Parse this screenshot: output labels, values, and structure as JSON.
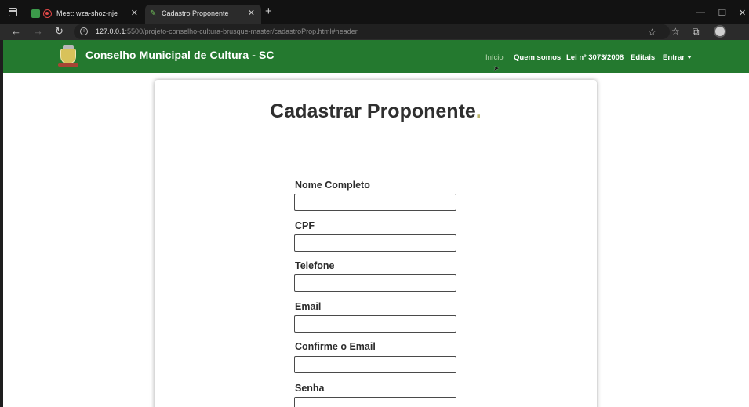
{
  "browser": {
    "tabs": [
      {
        "title": "Meet: wza-shoz-nje",
        "active": false
      },
      {
        "title": "Cadastro Proponente",
        "active": true
      }
    ],
    "new_tab_label": "+",
    "url_host": "127.0.0.1",
    "url_path": ":5500/projeto-conselho-cultura-brusque-master/cadastroProp.html#header"
  },
  "navbar": {
    "brand": "Conselho Municipal de Cultura - SC",
    "items": [
      {
        "label": "Início",
        "current": true
      },
      {
        "label": "Quem somos"
      },
      {
        "label": "Lei nº 3073/2008"
      },
      {
        "label": "Editais"
      },
      {
        "label": "Entrar"
      }
    ]
  },
  "form": {
    "title": "Cadastrar Proponente",
    "title_dot": ".",
    "fields": [
      {
        "label": "Nome Completo",
        "value": ""
      },
      {
        "label": "CPF",
        "value": ""
      },
      {
        "label": "Telefone",
        "value": ""
      },
      {
        "label": "Email",
        "value": ""
      },
      {
        "label": "Confirme o Email",
        "value": ""
      },
      {
        "label": "Senha",
        "value": ""
      }
    ]
  },
  "colors": {
    "navbar_green": "#24792f",
    "title_dot_accent": "#b9b36a"
  }
}
